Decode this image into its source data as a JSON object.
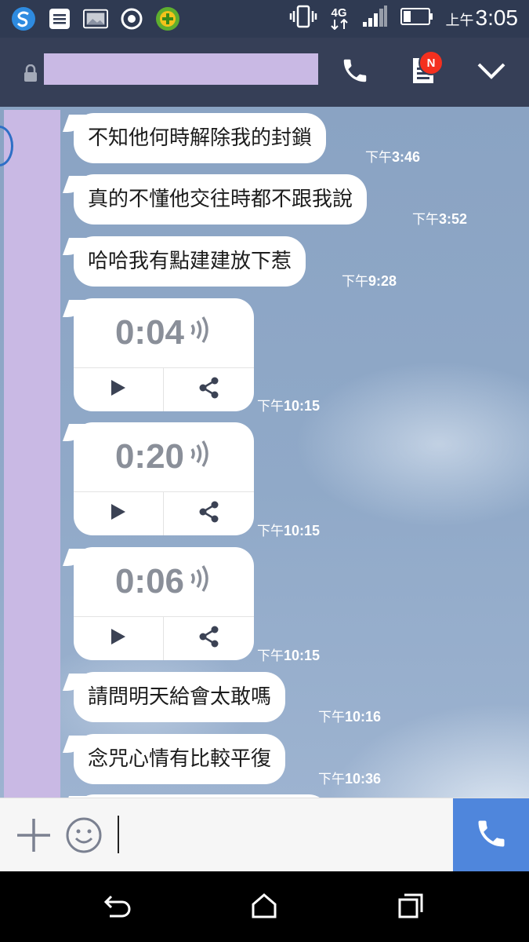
{
  "status_bar": {
    "network": "4G",
    "clock_prefix": "上午",
    "clock_time": "3:05",
    "notification_icons": [
      "browser-s-icon",
      "notes-icon",
      "image-icon",
      "record-icon",
      "game-icon"
    ],
    "right_icons": [
      "vibrate-icon",
      "signal-icon",
      "battery-icon"
    ]
  },
  "header": {
    "contact_name": "",
    "notes_badge": "N",
    "buttons": [
      "call-icon",
      "notes-icon",
      "chevron-down-icon"
    ]
  },
  "messages": [
    {
      "type": "text",
      "text": "不知他何時解除我的封鎖",
      "time_prefix": "下午",
      "time": "3:46"
    },
    {
      "type": "text",
      "text": "真的不懂他交往時都不跟我說",
      "time_prefix": "下午",
      "time": "3:52"
    },
    {
      "type": "text",
      "text": "哈哈我有點建建放下惹",
      "time_prefix": "下午",
      "time": "9:28"
    },
    {
      "type": "voice",
      "duration": "0:04",
      "time_prefix": "下午",
      "time": "10:15"
    },
    {
      "type": "voice",
      "duration": "0:20",
      "time_prefix": "下午",
      "time": "10:15"
    },
    {
      "type": "voice",
      "duration": "0:06",
      "time_prefix": "下午",
      "time": "10:15"
    },
    {
      "type": "text",
      "text": "請問明天給會太敢嗎",
      "time_prefix": "下午",
      "time": "10:16"
    },
    {
      "type": "text",
      "text": "念咒心情有比較平復",
      "time_prefix": "下午",
      "time": "10:36"
    }
  ],
  "input_bar": {
    "value": "",
    "buttons": [
      "plus-icon",
      "emoji-icon",
      "call-icon"
    ]
  },
  "nav_bar": {
    "buttons": [
      "back-icon",
      "home-icon",
      "recents-icon"
    ]
  },
  "colors": {
    "header": "#363f57",
    "status": "#2f3a52",
    "accent": "#4f86dc",
    "badge": "#f4301f",
    "redaction": "#c9b9e4"
  }
}
